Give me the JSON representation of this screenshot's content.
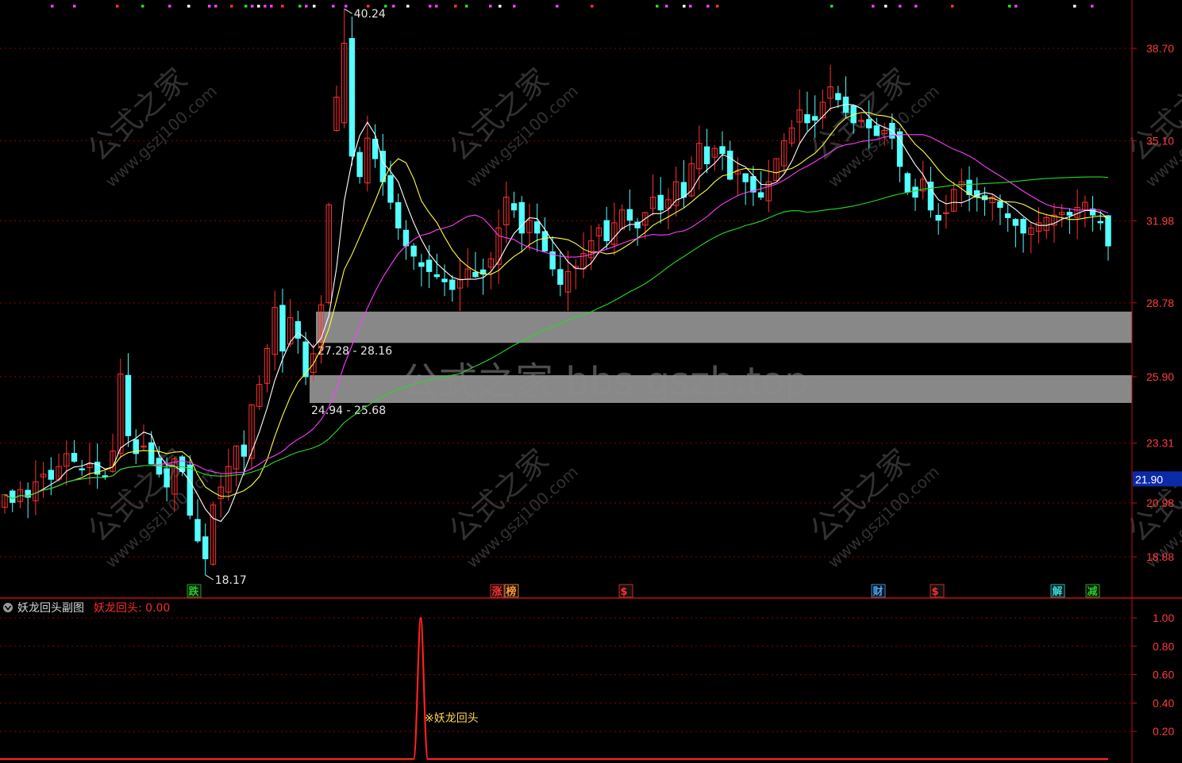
{
  "colors": {
    "background": "#000000",
    "up": "#ff3030",
    "down": "#54ffff",
    "grid": "#8b0000",
    "axis_text": "#ff3b3b",
    "ma5": "#ffffff",
    "ma10": "#ffff3c",
    "ma20": "#ff3cff",
    "ma60": "#22dd22",
    "zone": "#9b9b9b",
    "signal": "#ff2020"
  },
  "main_chart": {
    "y_ticks": [
      "38.70",
      "35.10",
      "31.98",
      "28.78",
      "25.90",
      "23.31",
      "20.98",
      "18.88"
    ],
    "current_price_label": "21.90",
    "high_label": "40.24",
    "low_label": "18.17",
    "zones": [
      {
        "label": "27.28 - 28.16",
        "low": 27.28,
        "high": 28.16
      },
      {
        "label": "24.94 - 25.68",
        "low": 24.94,
        "high": 25.68
      }
    ],
    "event_tags": [
      {
        "text": "跌",
        "color": "#22cc22"
      },
      {
        "text": "涨",
        "color": "#ff3030"
      },
      {
        "text": "榜",
        "color": "#ff9933"
      },
      {
        "text": "$",
        "color": "#ff3030"
      },
      {
        "text": "财",
        "color": "#4aa8ff"
      },
      {
        "text": "$",
        "color": "#ff3030"
      },
      {
        "text": "解",
        "color": "#33dddd"
      },
      {
        "text": "减",
        "color": "#22cc22"
      }
    ],
    "watermark_center": "公式之家 bbs.gszb.top",
    "watermark_tiles": {
      "cn": "公式之家",
      "url": "www.gszj100.com"
    }
  },
  "sub_chart": {
    "title": "妖龙回头副图",
    "value_label": "妖龙回头: 0.00",
    "signal_label": "※妖龙回头",
    "y_ticks": [
      "1.00",
      "0.80",
      "0.60",
      "0.40",
      "0.20"
    ]
  },
  "chart_data": {
    "type": "candlestick",
    "series": [
      {
        "name": "妖龙回头",
        "peak": 1.0,
        "baseline": 0.0
      }
    ],
    "ylim": [
      17.5,
      40.8
    ],
    "sub_ylim": [
      0,
      1.1
    ],
    "close_path": [
      21.3,
      21.0,
      21.5,
      21.2,
      21.8,
      22.1,
      21.9,
      22.4,
      22.9,
      22.6,
      22.3,
      22.5,
      22.1,
      22.0,
      23.0,
      26.0,
      23.6,
      22.9,
      23.2,
      22.5,
      22.1,
      21.6,
      22.7,
      22.2,
      20.5,
      19.5,
      18.8,
      20.9,
      21.6,
      22.4,
      23.2,
      22.8,
      24.8,
      25.6,
      27.0,
      28.6,
      26.9,
      28.2,
      27.4,
      25.9,
      26.8,
      28.7,
      32.6,
      36.8,
      38.9,
      34.5,
      33.7,
      35.2,
      34.4,
      33.5,
      32.7,
      31.7,
      31.0,
      30.6,
      30.2,
      30.0,
      29.8,
      29.6,
      29.3,
      29.7,
      30.1,
      29.8,
      29.9,
      30.5,
      31.7,
      32.9,
      32.4,
      31.5,
      32.0,
      31.5,
      30.8,
      30.1,
      29.5,
      30.0,
      30.2,
      30.7,
      31.2,
      31.7,
      31.2,
      31.9,
      32.4,
      32.0,
      31.7,
      32.3,
      32.9,
      32.4,
      32.8,
      33.5,
      32.9,
      34.2,
      35.0,
      34.2,
      34.8,
      34.6,
      33.6,
      33.9,
      33.5,
      33.1,
      32.9,
      33.5,
      34.4,
      35.1,
      35.6,
      36.3,
      35.8,
      35.9,
      36.6,
      37.2,
      36.7,
      36.2,
      35.8,
      35.9,
      35.6,
      35.3,
      35.5,
      35.2,
      34.1,
      33.1,
      32.9,
      33.6,
      32.4,
      32.0,
      32.3,
      33.2,
      33.5,
      33.0,
      32.9,
      32.8,
      32.9,
      32.5,
      32.1,
      31.8,
      31.5,
      31.7,
      31.9,
      32.1,
      32.2,
      32.3,
      32.2,
      32.5,
      32.7,
      32.2,
      31.9,
      31.0
    ],
    "subcategories": []
  }
}
